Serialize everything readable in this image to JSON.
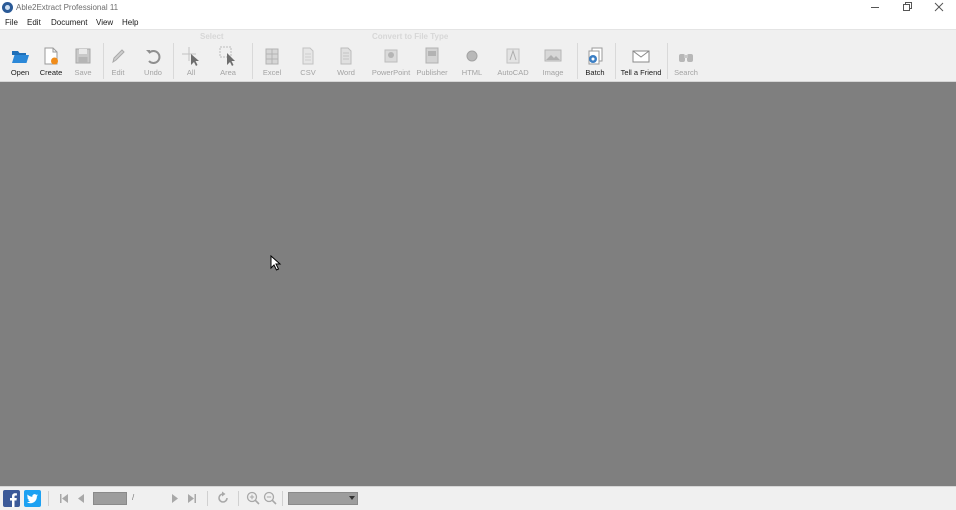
{
  "window": {
    "title": "Able2Extract Professional 11",
    "controls": [
      "minimize",
      "restore",
      "close"
    ]
  },
  "menu": [
    "File",
    "Edit",
    "Document",
    "View",
    "Help"
  ],
  "toolbar": {
    "groups": {
      "select": "Select",
      "convert": "Convert to File Type"
    },
    "buttons": {
      "open": "Open",
      "create": "Create",
      "save": "Save",
      "edit": "Edit",
      "undo": "Undo",
      "all": "All",
      "area": "Area",
      "excel": "Excel",
      "csv": "CSV",
      "word": "Word",
      "powerpoint": "PowerPoint",
      "publisher": "Publisher",
      "html": "HTML",
      "autocad": "AutoCAD",
      "image": "Image",
      "batch": "Batch",
      "tell_friend": "Tell a Friend",
      "search": "Search"
    }
  },
  "statusbar": {
    "page_value": "",
    "page_separator": "/",
    "page_total": "",
    "zoom_value": ""
  },
  "colors": {
    "workspace": "#7f7f7f",
    "toolbar": "#f0f0f0",
    "facebook": "#3b5998",
    "twitter": "#1da1f2",
    "open_icon": "#2b88d8",
    "create_star": "#f08c1a"
  }
}
